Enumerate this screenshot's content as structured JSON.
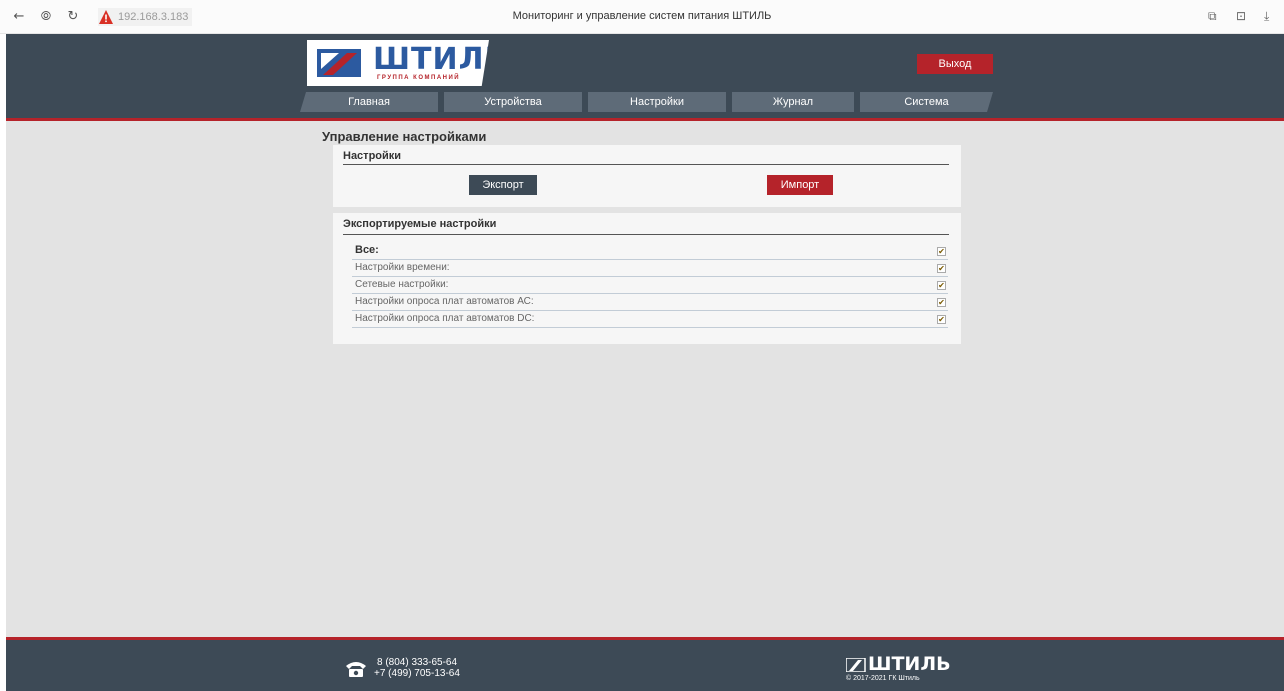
{
  "browser": {
    "back_icon": "←",
    "shield_icon": "⦾",
    "reload_icon": "↻",
    "url": "192.168.3.183",
    "tab_title": "Мониторинг и управление систем питания ШТИЛЬ",
    "bookmark_icon": "⧉",
    "extension_icon": "⊡",
    "download_icon": "⤓"
  },
  "header": {
    "logo_text": "ШТИЛЬ",
    "logo_sub": "ГРУППА КОМПАНИЙ",
    "logout_label": "Выход",
    "menu": [
      {
        "label": "Главная"
      },
      {
        "label": "Устройства"
      },
      {
        "label": "Настройки"
      },
      {
        "label": "Журнал"
      },
      {
        "label": "Система"
      }
    ]
  },
  "main": {
    "page_title": "Управление настройками",
    "settings_panel": {
      "title": "Настройки",
      "export_label": "Экспорт",
      "import_label": "Импорт"
    },
    "export_panel": {
      "title": "Экспортируемые настройки",
      "options": [
        {
          "label": "Все:",
          "checked": true
        },
        {
          "label": "Настройки времени:",
          "checked": true
        },
        {
          "label": "Сетевые настройки:",
          "checked": true
        },
        {
          "label": "Настройки опроса плат автоматов АС:",
          "checked": true
        },
        {
          "label": "Настройки опроса плат автоматов DC:",
          "checked": true
        }
      ],
      "check_mark": "✔"
    }
  },
  "footer": {
    "phone1": "8 (804) 333-65-64",
    "phone2": "+7 (499) 705-13-64",
    "logo_text": "ШТИЛЬ",
    "copyright": "© 2017-2021 ГК Штиль"
  },
  "colors": {
    "header_bg": "#3d4a56",
    "accent_red": "#b5232a",
    "content_bg": "#e3e3e3",
    "logo_blue": "#2c5aa0"
  }
}
